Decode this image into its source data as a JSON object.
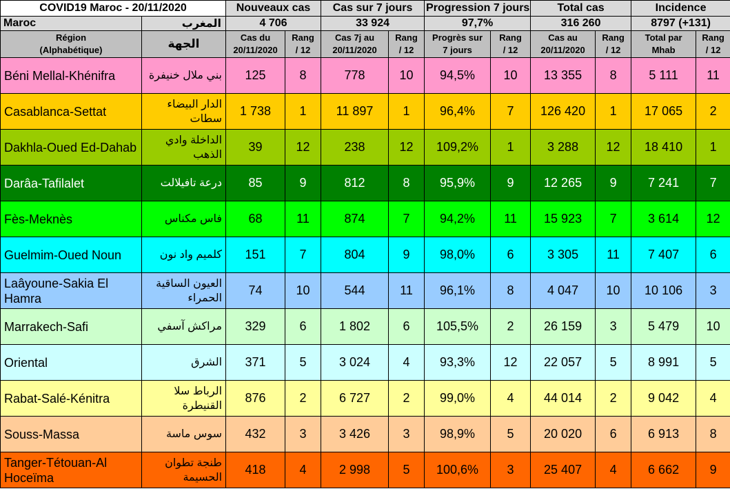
{
  "header": {
    "title": "COVID19 Maroc -  20/11/2020",
    "groups": [
      "Nouveaux cas",
      "Cas sur 7 jours",
      "Progression 7 jours",
      "Total cas",
      "Incidence"
    ]
  },
  "national": {
    "name_fr": "Maroc",
    "name_ar": "المغرب",
    "values": [
      "4 706",
      "33 924",
      "97,7%",
      "316 260",
      "8797 (+131)"
    ]
  },
  "subheader": {
    "region_label": "Région\n(Alphabétique)",
    "arabic_label": "الجهة",
    "columns": [
      "Cas du\n20/11/2020",
      "Rang\n/ 12",
      "Cas 7j au\n20/11/2020",
      "Rang\n/ 12",
      "Progrès sur\n7 jours",
      "Rang\n/ 12",
      "Cas au\n20/11/2020",
      "Rang\n/ 12",
      "Total par\nMhab",
      "Rang\n/ 12"
    ]
  },
  "colors": {
    "header_gray": "#d9d9d9",
    "subheader_gray": "#c0c0c0"
  },
  "regions": [
    {
      "name_fr": "Béni Mellal-Khénifra",
      "name_ar": "بني ملال خنيفرة",
      "color": "#ff99cc",
      "text_color": "#000000",
      "values": [
        "125",
        "8",
        "778",
        "10",
        "94,5%",
        "10",
        "13 355",
        "8",
        "5 111",
        "11"
      ]
    },
    {
      "name_fr": "Casablanca-Settat",
      "name_ar": "الدار البيضاء سطات",
      "color": "#ffcc00",
      "text_color": "#000000",
      "values": [
        "1 738",
        "1",
        "11 897",
        "1",
        "96,4%",
        "7",
        "126 420",
        "1",
        "17 065",
        "2"
      ]
    },
    {
      "name_fr": "Dakhla-Oued Ed-Dahab",
      "name_ar": "الداخلة وادي الذهب",
      "color": "#99cc00",
      "text_color": "#000000",
      "values": [
        "39",
        "12",
        "238",
        "12",
        "109,2%",
        "1",
        "3 288",
        "12",
        "18 410",
        "1"
      ]
    },
    {
      "name_fr": "Darâa-Tafilalet",
      "name_ar": "درعة تافيلالت",
      "color": "#008000",
      "text_color": "#ffffff",
      "values": [
        "85",
        "9",
        "812",
        "8",
        "95,9%",
        "9",
        "12 265",
        "9",
        "7 241",
        "7"
      ]
    },
    {
      "name_fr": "Fès-Meknès",
      "name_ar": "فاس مكناس",
      "color": "#00ff00",
      "text_color": "#000000",
      "values": [
        "68",
        "11",
        "874",
        "7",
        "94,2%",
        "11",
        "15 923",
        "7",
        "3 614",
        "12"
      ]
    },
    {
      "name_fr": "Guelmim-Oued Noun",
      "name_ar": "كلميم واد نون",
      "color": "#00ffff",
      "text_color": "#000000",
      "values": [
        "151",
        "7",
        "804",
        "9",
        "98,0%",
        "6",
        "3 305",
        "11",
        "7 407",
        "6"
      ]
    },
    {
      "name_fr": "Laâyoune-Sakia El Hamra",
      "name_ar": "العيون الساقية الحمراء",
      "color": "#99ccff",
      "text_color": "#000000",
      "values": [
        "74",
        "10",
        "544",
        "11",
        "96,1%",
        "8",
        "4 047",
        "10",
        "10 106",
        "3"
      ]
    },
    {
      "name_fr": "Marrakech-Safi",
      "name_ar": "مراكش آسفي",
      "color": "#ccffcc",
      "text_color": "#000000",
      "values": [
        "329",
        "6",
        "1 802",
        "6",
        "105,5%",
        "2",
        "26 159",
        "3",
        "5 479",
        "10"
      ]
    },
    {
      "name_fr": "Oriental",
      "name_ar": "الشرق",
      "color": "#ccffff",
      "text_color": "#000000",
      "values": [
        "371",
        "5",
        "3 024",
        "4",
        "93,3%",
        "12",
        "22 057",
        "5",
        "8 991",
        "5"
      ]
    },
    {
      "name_fr": "Rabat-Salé-Kénitra",
      "name_ar": "الرباط سلا القنيطرة",
      "color": "#ffff99",
      "text_color": "#000000",
      "values": [
        "876",
        "2",
        "6 727",
        "2",
        "99,0%",
        "4",
        "44 014",
        "2",
        "9 042",
        "4"
      ]
    },
    {
      "name_fr": "Souss-Massa",
      "name_ar": "سوس ماسة",
      "color": "#ffcc99",
      "text_color": "#000000",
      "values": [
        "432",
        "3",
        "3 426",
        "3",
        "98,9%",
        "5",
        "20 020",
        "6",
        "6 913",
        "8"
      ]
    },
    {
      "name_fr": "Tanger-Tétouan-Al Hoceïma",
      "name_ar": "طنجة تطوان الحسيمة",
      "color": "#ff6600",
      "text_color": "#000000",
      "values": [
        "418",
        "4",
        "2 998",
        "5",
        "100,6%",
        "3",
        "25 407",
        "4",
        "6 662",
        "9"
      ]
    }
  ]
}
